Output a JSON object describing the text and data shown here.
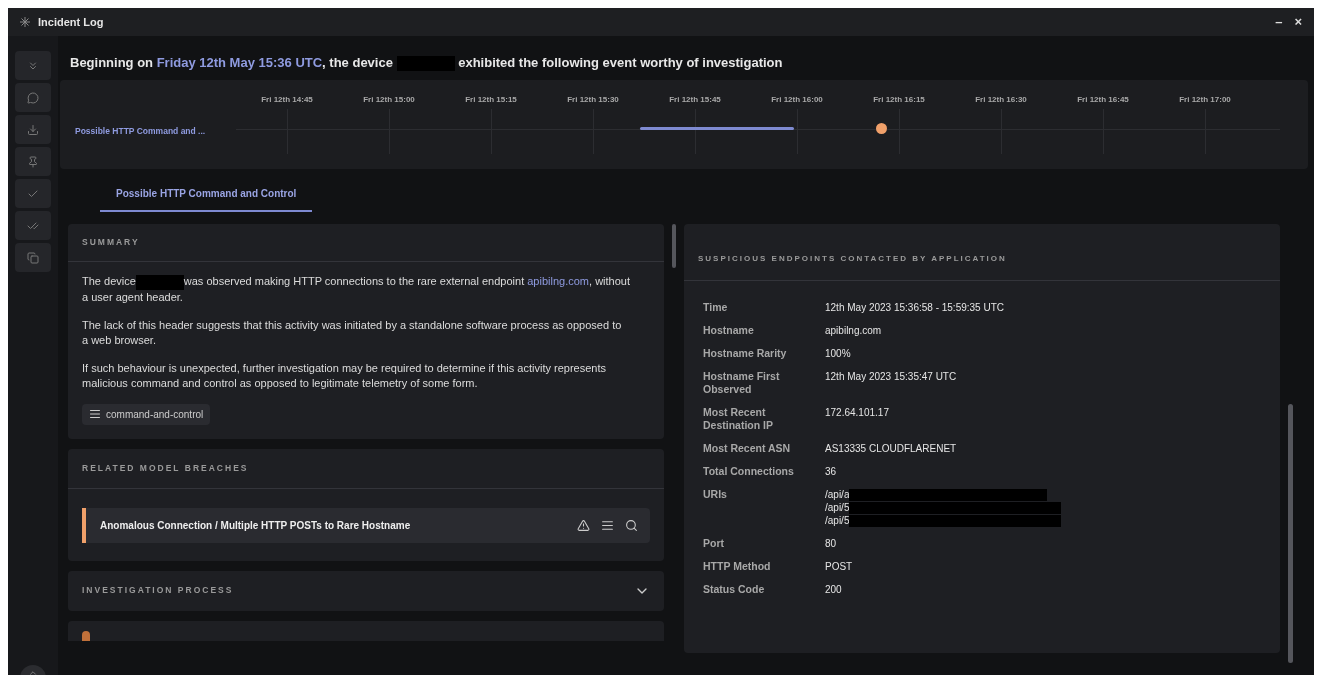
{
  "window": {
    "title": "Incident Log",
    "controls": [
      "–",
      "×"
    ]
  },
  "headline": {
    "prefix": "Beginning on ",
    "date": "Friday 12th May 15:36 UTC",
    "middle": ", the device",
    "suffix": "exhibited the following event worthy of investigation"
  },
  "timeline": {
    "event_label": "Possible HTTP Command and ...",
    "ticks": [
      "Fri 12th 14:45",
      "Fri 12th 15:00",
      "Fri 12th 15:15",
      "Fri 12th 15:30",
      "Fri 12th 15:45",
      "Fri 12th 16:00",
      "Fri 12th 16:15",
      "Fri 12th 16:30",
      "Fri 12th 16:45",
      "Fri 12th 17:00"
    ]
  },
  "tabs": [
    {
      "label": "Possible HTTP Command and Control",
      "selected": true
    }
  ],
  "summary": {
    "title": "SUMMARY",
    "paragraphs": [
      {
        "before": "The device",
        "after_redaction": "was observed making HTTP connections to the rare external endpoint ",
        "link": "apibilng.com",
        "after": ", without a user agent header."
      },
      {
        "before": "The lack of this header suggests that this activity was initiated by a standalone software process as opposed to a web browser."
      },
      {
        "before": "If such behaviour is unexpected, further investigation may be required to determine if this activity represents malicious command and control as opposed to legitimate telemetry of some form."
      }
    ],
    "tag": "command-and-control"
  },
  "breaches": {
    "title": "RELATED MODEL BREACHES",
    "items": [
      {
        "label": "Anomalous Connection / Multiple HTTP POSTs to Rare Hostname",
        "color": "#f0a06a"
      }
    ]
  },
  "investigation": {
    "title": "INVESTIGATION PROCESS",
    "expanded": false
  },
  "endpoints": {
    "title": "SUSPICIOUS ENDPOINTS CONTACTED BY APPLICATION",
    "rows": [
      {
        "label": "Time",
        "values": [
          "12th May 2023 15:36:58 - 15:59:35 UTC"
        ]
      },
      {
        "label": "Hostname",
        "values": [
          "apibilng.com"
        ]
      },
      {
        "label": "Hostname Rarity",
        "values": [
          "100%"
        ]
      },
      {
        "label": "Hostname First Observed",
        "values": [
          "12th May 2023 15:35:47 UTC"
        ]
      },
      {
        "label": "Most Recent Destination IP",
        "values": [
          "172.64.101.17"
        ]
      },
      {
        "label": "Most Recent ASN",
        "values": [
          "AS13335 CLOUDFLARENET"
        ]
      },
      {
        "label": "Total Connections",
        "values": [
          "36"
        ]
      },
      {
        "label": "URIs",
        "values": [
          "/api/a",
          "/api/5",
          "/api/5"
        ],
        "redacted": true
      },
      {
        "label": "Port",
        "values": [
          "80"
        ]
      },
      {
        "label": "HTTP Method",
        "values": [
          "POST"
        ]
      },
      {
        "label": "Status Code",
        "values": [
          "200"
        ]
      }
    ]
  }
}
